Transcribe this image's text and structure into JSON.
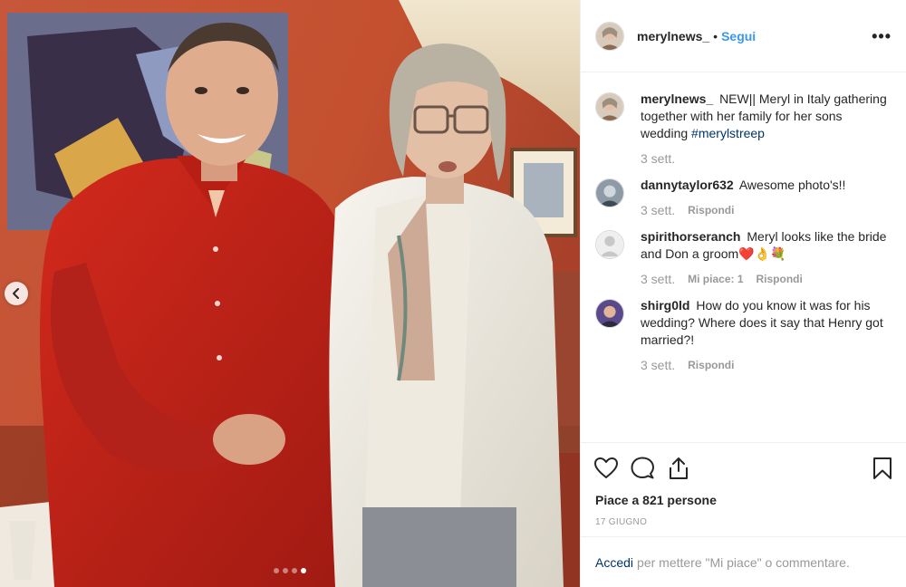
{
  "post": {
    "author": "merylnews_",
    "separator": "•",
    "follow_label": "Segui",
    "more_label": "•••"
  },
  "media": {
    "photo_description": "",
    "dots_total": 4,
    "dots_active": 3
  },
  "caption": {
    "user": "merylnews_",
    "text": "NEW|| Meryl in Italy gathering together with her family for her sons wedding",
    "hashtag": "#merylstreep",
    "time": "3 sett."
  },
  "comments": [
    {
      "user": "dannytaylor632",
      "text": "Awesome photo's!!",
      "emoji": "",
      "time": "3 sett.",
      "likes": "",
      "reply": "Rispondi"
    },
    {
      "user": "spirithorseranch",
      "text": "Meryl looks like the bride and Don a groom",
      "emoji": "❤️👌💐",
      "time": "3 sett.",
      "likes": "Mi piace: 1",
      "reply": "Rispondi"
    },
    {
      "user": "shirg0ld",
      "text": "How do you know it was for his wedding? Where does it say that Henry got married?!",
      "emoji": "",
      "time": "3 sett.",
      "likes": "",
      "reply": "Rispondi"
    }
  ],
  "likes_text": "Piace a 821 persone",
  "date_text": "17 GIUGNO",
  "footer": {
    "login_label": "Accedi",
    "rest_text": "per mettere \"Mi piace\" o commentare."
  },
  "icons": {
    "like": "heart-icon",
    "comment": "comment-bubble-icon",
    "share": "share-icon",
    "save": "bookmark-icon",
    "prev": "chevron-left-icon"
  },
  "colors": {
    "link_blue": "#3897f0",
    "hashtag_navy": "#003569",
    "meta_gray": "#999999",
    "wall_orange": "#b3492c",
    "shirt_red": "#c0241b"
  }
}
